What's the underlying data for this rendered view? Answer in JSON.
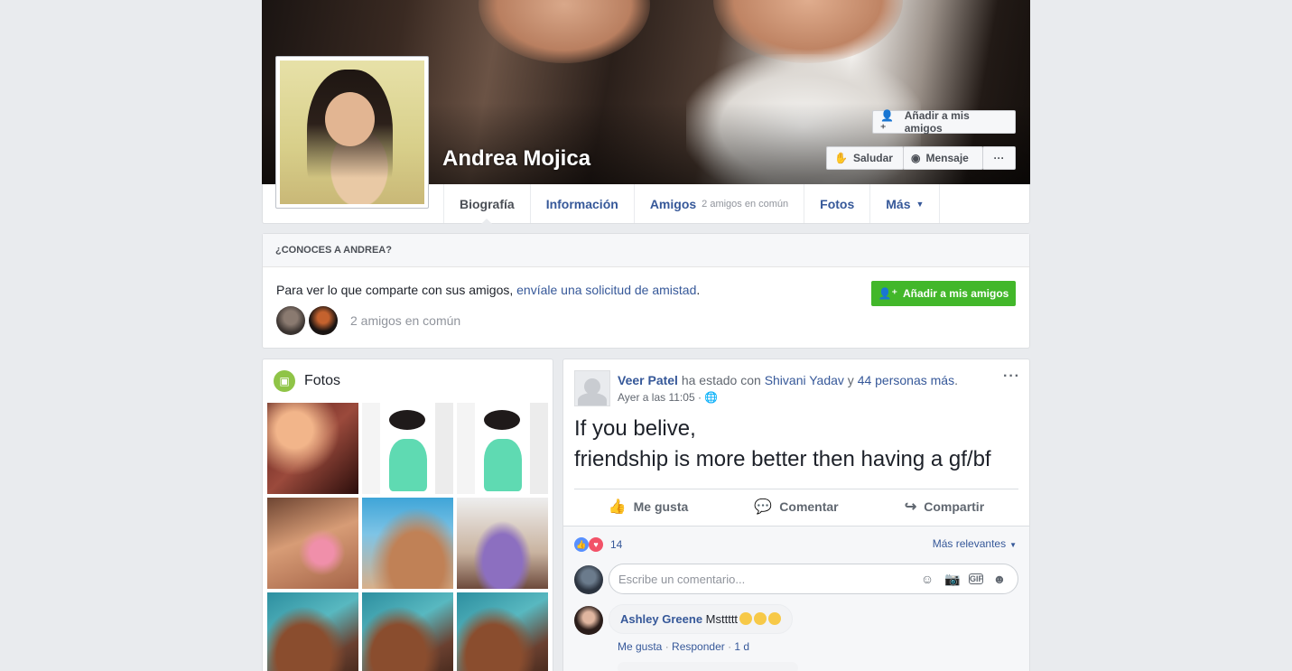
{
  "profile": {
    "name": "Andrea Mojica"
  },
  "cover_actions": {
    "add_friend": "Añadir a mis amigos",
    "wave": "Saludar",
    "message": "Mensaje",
    "more": "···"
  },
  "tabs": [
    {
      "label": "Biografía"
    },
    {
      "label": "Información"
    },
    {
      "label": "Amigos",
      "sub": "2 amigos en común"
    },
    {
      "label": "Fotos"
    },
    {
      "label": "Más"
    }
  ],
  "know": {
    "header": "¿CONOCES A ANDREA?",
    "text": "Para ver lo que comparte con sus amigos, ",
    "link": "envíale una solicitud de amistad",
    "text_end": ".",
    "mutual": "2 amigos en común",
    "add_button": "Añadir a mis amigos"
  },
  "photos": {
    "title": "Fotos"
  },
  "post": {
    "author": "Veer Patel",
    "with_text": " ha estado con ",
    "tagged": "Shivani Yadav",
    "and_text": " y ",
    "others": "44 personas más",
    "period": ".",
    "time": "Ayer a las 11:05",
    "line1": "If you belive,",
    "line2": "friendship is more better then having a gf/bf",
    "like": "Me gusta",
    "comment": "Comentar",
    "share": "Compartir",
    "reaction_count": "14",
    "sort": "Más relevantes",
    "comment_placeholder": "Escribe un comentario..."
  },
  "comment": {
    "author": "Ashley Greene",
    "text": " Msttttt",
    "like": "Me gusta",
    "reply": "Responder",
    "age": "1 d"
  },
  "colors": {
    "link": "#365899",
    "green": "#42b72a",
    "background": "#e9ebee"
  }
}
